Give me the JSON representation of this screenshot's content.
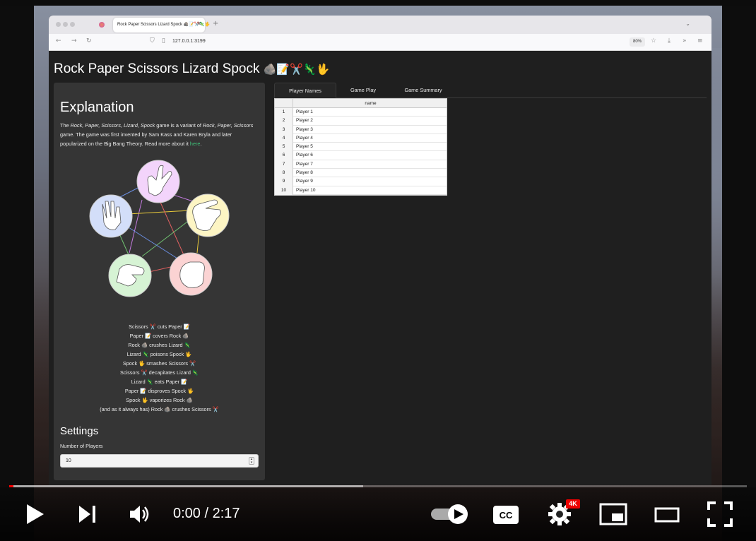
{
  "browser": {
    "tab_title": "Rock Paper Scissors Lizard Spock 🪨📝✂️🦎🖖",
    "url": "127.0.0.1:3199",
    "zoom": "80%"
  },
  "page": {
    "title": "Rock Paper Scissors Lizard Spock",
    "title_emoji": "🪨📝✂️🦎🖖",
    "explanation": {
      "heading": "Explanation",
      "text_pre": "The ",
      "text_em1": "Rock, Paper, Scissors, Lizard, Spock",
      "text_mid1": " game is a variant of ",
      "text_em2": "Rock, Paper, Scissors",
      "text_mid2": " game. The game was first invented by Sam Kass and Karen Bryla and later popularized on the Big Bang Theory. Read more about it ",
      "link": "here",
      "text_end": "."
    },
    "rules": [
      "Scissors ✂️ cuts Paper 📝",
      "Paper 📝 covers Rock 🪨",
      "Rock 🪨 crushes Lizard 🦎",
      "Lizard 🦎 poisons Spock 🖖",
      "Spock 🖖 smashes Scissors ✂️",
      "Scissors ✂️ decapitates Lizard 🦎",
      "Lizard 🦎 eats Paper 📝",
      "Paper 📝 disproves Spock 🖖",
      "Spock 🖖 vaporizes Rock 🪨",
      "(and as it always has) Rock 🪨 crushes Scissors ✂️"
    ],
    "settings": {
      "heading": "Settings",
      "num_players_label": "Number of Players",
      "num_players_value": "10"
    },
    "tabs": [
      "Player Names",
      "Game Play",
      "Game Summary"
    ],
    "table": {
      "column": "name",
      "rows": [
        {
          "idx": "1",
          "name": "Player 1"
        },
        {
          "idx": "2",
          "name": "Player 2"
        },
        {
          "idx": "3",
          "name": "Player 3"
        },
        {
          "idx": "4",
          "name": "Player 4"
        },
        {
          "idx": "5",
          "name": "Player 5"
        },
        {
          "idx": "6",
          "name": "Player 6"
        },
        {
          "idx": "7",
          "name": "Player 7"
        },
        {
          "idx": "8",
          "name": "Player 8"
        },
        {
          "idx": "9",
          "name": "Player 9"
        },
        {
          "idx": "10",
          "name": "Player 10"
        }
      ]
    }
  },
  "player": {
    "time": "0:00 / 2:17",
    "quality_badge": "4K",
    "progress_buffered_fraction": 0.48,
    "progress_played_fraction": 0.006
  },
  "colors": {
    "diagram_scissors": "#f3d4fb",
    "diagram_paper": "#fdf5c4",
    "diagram_rock": "#fbd3d3",
    "diagram_lizard": "#d6f3d4",
    "diagram_spock": "#d3def9",
    "link": "#3fc27a",
    "progress": "#ff0000"
  }
}
